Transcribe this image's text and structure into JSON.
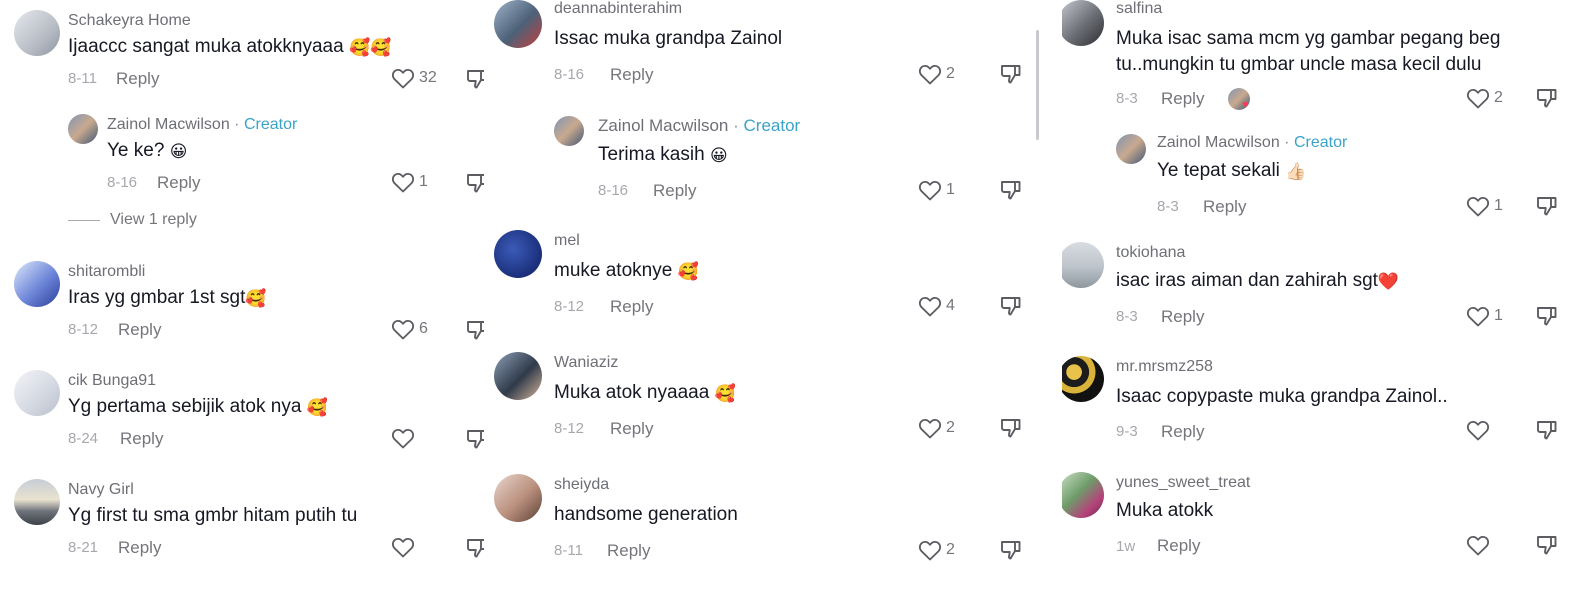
{
  "col1": {
    "c1": {
      "user": "Schakeyra Home",
      "text": "Ijaaccc sangat muka atokknyaaa",
      "emoji": "🥰🥰",
      "date": "8-11",
      "reply": "Reply",
      "likes": "32"
    },
    "r1": {
      "user": "Zainol Macwilson",
      "dot": "·",
      "creator": "Creator",
      "text": "Ye ke?",
      "emoji": "😀",
      "date": "8-16",
      "reply": "Reply",
      "likes": "1"
    },
    "view": "View 1 reply",
    "c2": {
      "user": "shitarombli",
      "text": "Iras yg gmbar 1st sgt",
      "emoji": "🥰",
      "date": "8-12",
      "reply": "Reply",
      "likes": "6"
    },
    "c3": {
      "user": "cik Bunga91",
      "text": "Yg pertama sebijik atok nya",
      "emoji": "🥰",
      "date": "8-24",
      "reply": "Reply",
      "likes": ""
    },
    "c4": {
      "user": "Navy Girl",
      "text": "Yg first tu sma gmbr hitam putih tu",
      "date": "8-21",
      "reply": "Reply",
      "likes": ""
    }
  },
  "col2": {
    "c1": {
      "user": "deannabinterahim",
      "text": "Issac muka grandpa Zainol",
      "date": "8-16",
      "reply": "Reply",
      "likes": "2"
    },
    "r1": {
      "user": "Zainol Macwilson",
      "dot": "·",
      "creator": "Creator",
      "text": "Terima kasih",
      "emoji": "😀",
      "date": "8-16",
      "reply": "Reply",
      "likes": "1"
    },
    "c2": {
      "user": "mel",
      "text": "muke atoknye",
      "emoji": "🥰",
      "date": "8-12",
      "reply": "Reply",
      "likes": "4"
    },
    "c3": {
      "user": "Waniaziz",
      "text": "Muka atok nyaaaa",
      "emoji": "🥰",
      "date": "8-12",
      "reply": "Reply",
      "likes": "2"
    },
    "c4": {
      "user": "sheiyda",
      "text": "handsome generation",
      "date": "8-11",
      "reply": "Reply",
      "likes": "2"
    }
  },
  "col3": {
    "c1": {
      "user": "salfina",
      "text": "Muka isac sama mcm yg gambar pegang beg tu..mungkin tu gmbar uncle masa kecil dulu",
      "date": "8-3",
      "reply": "Reply",
      "likes": "2"
    },
    "r1": {
      "user": "Zainol Macwilson",
      "dot": "·",
      "creator": "Creator",
      "text": "Ye tepat sekali",
      "emoji": "👍🏻",
      "date": "8-3",
      "reply": "Reply",
      "likes": "1"
    },
    "c2": {
      "user": "tokiohana",
      "text": "isac iras aiman dan zahirah sgt",
      "emoji": "❤️",
      "date": "8-3",
      "reply": "Reply",
      "likes": "1"
    },
    "c3": {
      "user": "mr.mrsmz258",
      "text": "Isaac copypaste muka grandpa Zainol..",
      "date": "9-3",
      "reply": "Reply",
      "likes": ""
    },
    "c4": {
      "user": "yunes_sweet_treat",
      "text": "Muka atokk",
      "date": "1w",
      "reply": "Reply",
      "likes": ""
    }
  },
  "icons": {
    "like": "heart-outline-icon",
    "dislike": "thumbs-down-icon"
  },
  "colors": {
    "creator": "#3aa3c7",
    "text": "#161823",
    "muted": "#75767c"
  }
}
